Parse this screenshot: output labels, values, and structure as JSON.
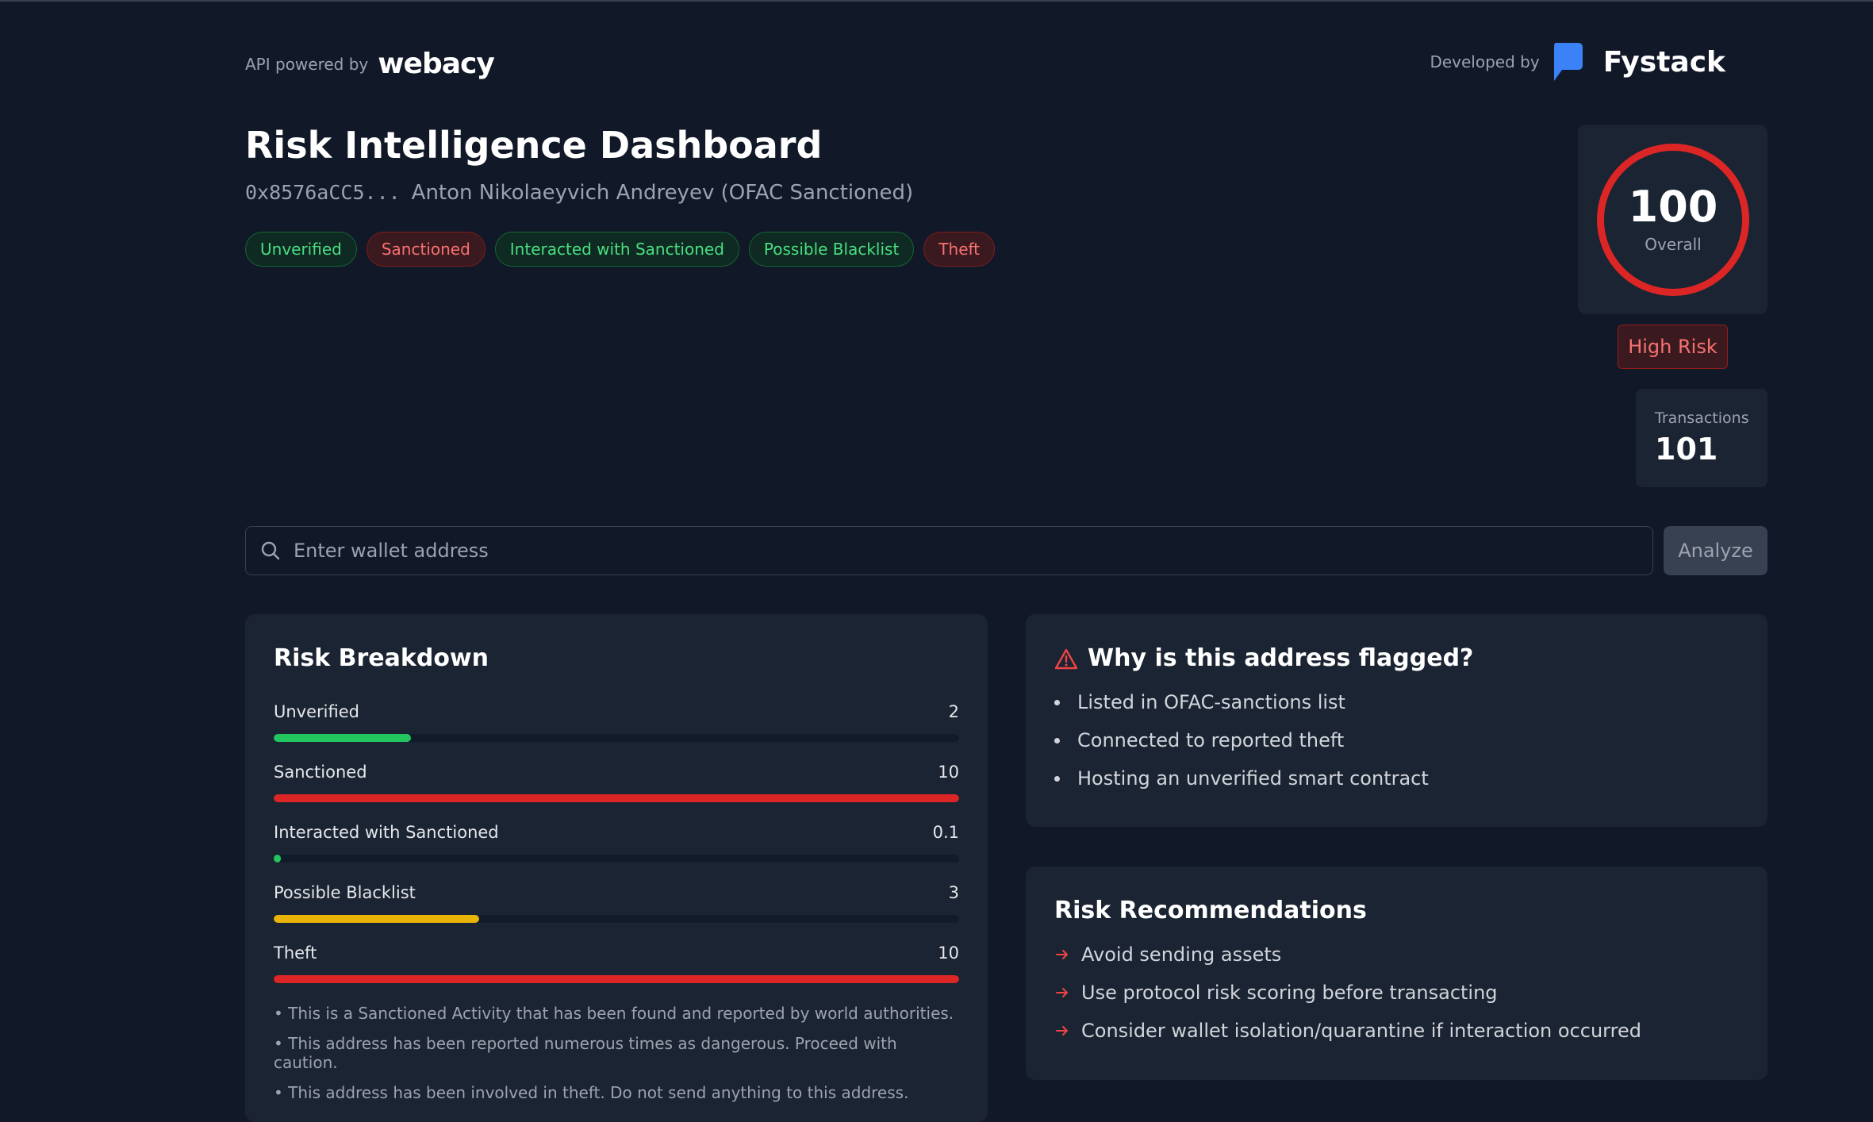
{
  "header": {
    "powered_label": "API powered by",
    "powered_brand": "webacy",
    "developed_label": "Developed by",
    "developed_brand": "Fystack"
  },
  "title": "Risk Intelligence Dashboard",
  "address": "0x8576aCC5...",
  "entity_name": "Anton Nikolaeyvich Andreyev (OFAC Sanctioned)",
  "tags": [
    {
      "label": "Unverified",
      "tone": "green"
    },
    {
      "label": "Sanctioned",
      "tone": "red"
    },
    {
      "label": "Interacted with Sanctioned",
      "tone": "green"
    },
    {
      "label": "Possible Blacklist",
      "tone": "green"
    },
    {
      "label": "Theft",
      "tone": "red"
    }
  ],
  "score": {
    "value": "100",
    "label": "Overall",
    "ring_color": "#dc2626"
  },
  "risk_level": "High Risk",
  "transactions": {
    "label": "Transactions",
    "value": "101"
  },
  "search": {
    "placeholder": "Enter wallet address",
    "value": "",
    "button": "Analyze"
  },
  "breakdown": {
    "title": "Risk Breakdown",
    "max": 10,
    "items": [
      {
        "label": "Unverified",
        "value": "2",
        "fraction": 0.2,
        "color": "#22c55e"
      },
      {
        "label": "Sanctioned",
        "value": "10",
        "fraction": 1.0,
        "color": "#dc2626"
      },
      {
        "label": "Interacted with Sanctioned",
        "value": "0.1",
        "fraction": 0.01,
        "color": "#22c55e"
      },
      {
        "label": "Possible Blacklist",
        "value": "3",
        "fraction": 0.3,
        "color": "#eab308"
      },
      {
        "label": "Theft",
        "value": "10",
        "fraction": 1.0,
        "color": "#dc2626"
      }
    ],
    "notes": [
      "• This is a Sanctioned Activity that has been found and reported by world authorities.",
      "• This address has been reported numerous times as dangerous. Proceed with caution.",
      "• This address has been involved in theft. Do not send anything to this address."
    ]
  },
  "flagged": {
    "title": "Why is this address flagged?",
    "items": [
      "Listed in OFAC-sanctions list",
      "Connected to reported theft",
      "Hosting an unverified smart contract"
    ]
  },
  "recommendations": {
    "title": "Risk Recommendations",
    "items": [
      "Avoid sending assets",
      "Use protocol risk scoring before transacting",
      "Consider wallet isolation/quarantine if interaction occurred"
    ]
  }
}
